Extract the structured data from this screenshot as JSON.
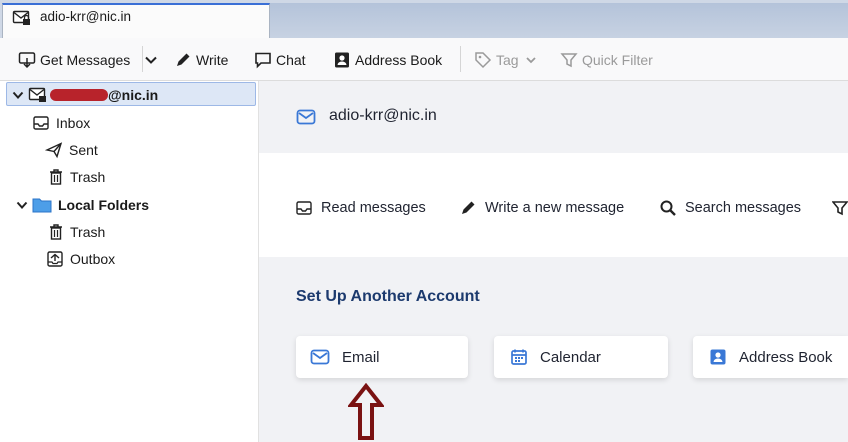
{
  "tab": {
    "title": "adio-krr@nic.in"
  },
  "toolbar": {
    "get_messages": "Get Messages",
    "write": "Write",
    "chat": "Chat",
    "address_book": "Address Book",
    "tag": "Tag",
    "quick_filter": "Quick Filter"
  },
  "folders": {
    "account_suffix": "@nic.in",
    "inbox": "Inbox",
    "sent": "Sent",
    "trash": "Trash",
    "local_folders": "Local Folders",
    "local_trash": "Trash",
    "outbox": "Outbox"
  },
  "content": {
    "account_title": "adio-krr@nic.in",
    "read_messages": "Read messages",
    "write_message": "Write a new message",
    "search_messages": "Search messages",
    "setup_title": "Set Up Another Account",
    "email": "Email",
    "calendar": "Calendar",
    "address_book": "Address Book"
  },
  "colors": {
    "accent": "#3a78d6",
    "annotation_arrow": "#7a1212"
  }
}
